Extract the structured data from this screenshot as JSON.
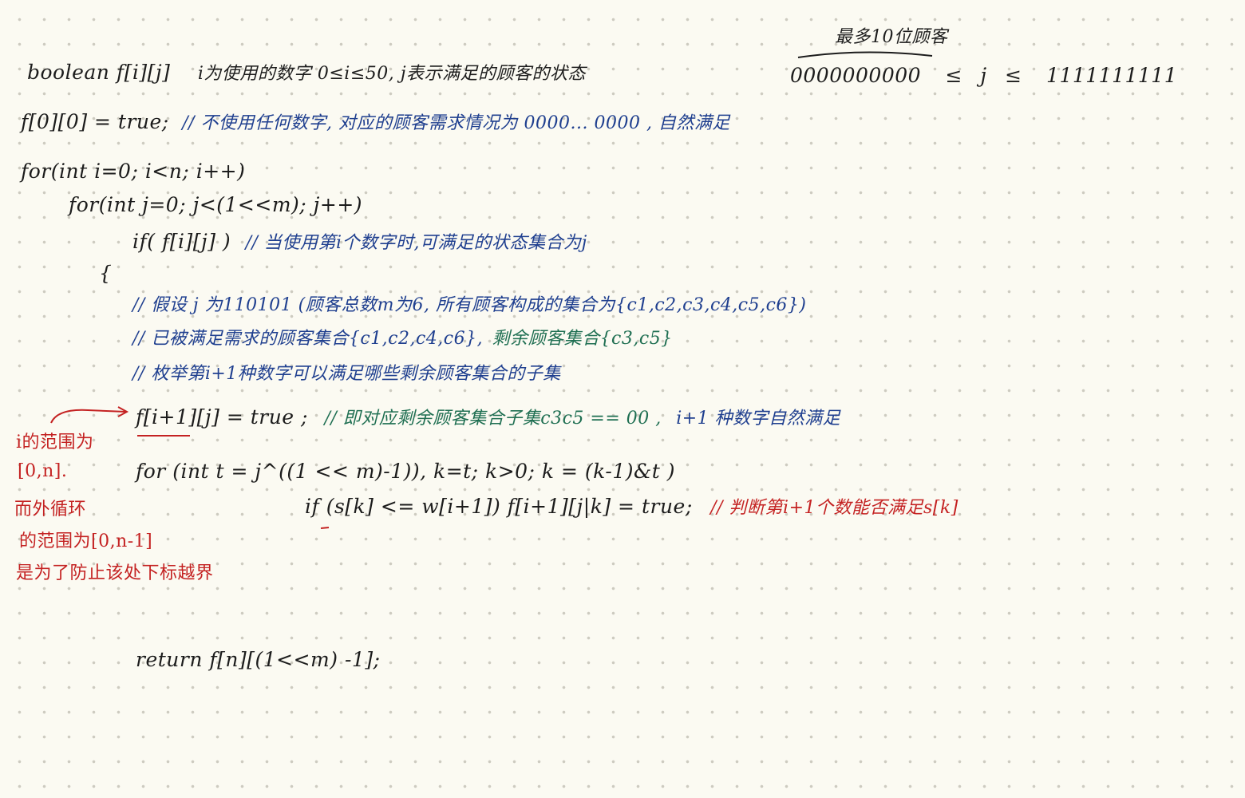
{
  "colors": {
    "paper": "#fbfaf2",
    "ink_black": "#1c1c1c",
    "ink_blue": "#1f3f8f",
    "ink_green": "#1f6f52",
    "ink_red": "#c42222",
    "dot_grid": "#cdcbc0"
  },
  "lines": {
    "l1": {
      "code": "boolean f[i][j]",
      "comment": "i为使用的数字 0≤i≤50, j表示满足的顾客的状态",
      "range_low": "0000000000",
      "le1": "≤",
      "var_j": "j",
      "le2": "≤",
      "range_high": "1111111111",
      "annotation_top": "最多10位顾客"
    },
    "l2": {
      "code": "f[0][0] = true;",
      "comment": "// 不使用任何数字, 对应的顾客需求情况为 0000... 0000 , 自然满足"
    },
    "l3": {
      "code": "for(int i=0; i<n; i++)"
    },
    "l4": {
      "code": "for(int j=0; j<(1<<m); j++)"
    },
    "l5": {
      "code": "if( f[i][j] )",
      "comment": "// 当使用第i个数字时,可满足的状态集合为j"
    },
    "l6": {
      "code": "{"
    },
    "l7": {
      "comment": "// 假设 j 为110101 (顾客总数m为6, 所有顾客构成的集合为{c1,c2,c3,c4,c5,c6})"
    },
    "l8": {
      "comment_a": "// 已被满足需求的顾客集合{c1,c2,c4,c6},",
      "comment_b": "剩余顾客集合{c3,c5}"
    },
    "l9": {
      "comment": "// 枚举第i+1种数字可以满足哪些剩余顾客集合的子集"
    },
    "l10": {
      "code": "f[i+1][j] = true ;",
      "comment_a": "// 即对应剩余顾客集合子集c3c5 == 00 ,",
      "comment_b": "i+1 种数字自然满足"
    },
    "l11": {
      "code": "for (int t = j^((1 << m)-1)), k=t; k>0; k = (k-1)&t )"
    },
    "l12": {
      "code": "if (s[k] <= w[i+1]) f[i+1][j|k] = true;",
      "comment": "// 判断第i+1个数能否满足s[k]"
    },
    "l13": {
      "code": "return f[n][(1<<m) -1];"
    }
  },
  "side_note": [
    "i的范围为",
    "[0,n].",
    "而外循环",
    "的范围为[0,n-1]",
    "是为了防止该处下标越界"
  ]
}
